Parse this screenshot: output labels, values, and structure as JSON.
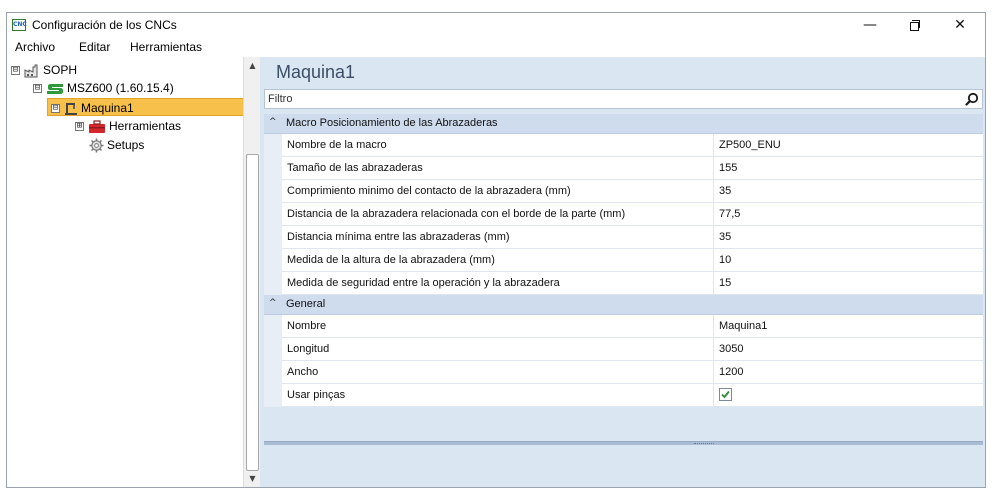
{
  "window": {
    "title": "Configuración de los CNCs",
    "app_icon": "cnc-app-icon",
    "app_icon_text": "CNC",
    "controls": {
      "minimize": "—",
      "close": "✕"
    }
  },
  "menu": {
    "items": [
      "Archivo",
      "Editar",
      "Herramientas"
    ]
  },
  "tree": {
    "nodes": [
      {
        "label": "SOPH",
        "icon": "factory-icon",
        "expander": "⊟"
      },
      {
        "label": "MSZ600 (1.60.15.4)",
        "icon": "s-logo-icon",
        "expander": "⊟"
      },
      {
        "label": "Maquina1",
        "icon": "machine-icon",
        "expander": "⊟",
        "selected": true
      },
      {
        "label": "Herramientas",
        "icon": "toolbox-icon",
        "expander": "⊞"
      },
      {
        "label": "Setups",
        "icon": "gear-icon"
      }
    ]
  },
  "scrollbar": {
    "up": "▲",
    "down": "▼"
  },
  "properties": {
    "title": "Maquina1",
    "filter_label": "Filtro",
    "toggle_symbol": "^",
    "categories": [
      {
        "label": "Macro Posicionamiento de las Abrazaderas",
        "rows": [
          {
            "name": "Nombre de la macro",
            "value": "ZP500_ENU"
          },
          {
            "name": "Tamaño de las abrazaderas",
            "value": "155"
          },
          {
            "name": "Comprimiento minimo del contacto de la abrazadera (mm)",
            "value": "35"
          },
          {
            "name": "Distancia de la abrazadera relacionada con el borde de la parte (mm)",
            "value": "77,5"
          },
          {
            "name": "Distancia mínima entre las abrazaderas (mm)",
            "value": "35"
          },
          {
            "name": "Medida de la altura de la abrazadera (mm)",
            "value": "10"
          },
          {
            "name": "Medida de seguridad entre la operación y la abrazadera",
            "value": "15"
          }
        ]
      },
      {
        "label": "General",
        "rows": [
          {
            "name": "Nombre",
            "value": "Maquina1"
          },
          {
            "name": "Longitud",
            "value": "3050"
          },
          {
            "name": "Ancho",
            "value": "1200"
          },
          {
            "name": "Usar pinças",
            "checked": true
          }
        ]
      }
    ]
  },
  "colors": {
    "selection": "#f7c04b",
    "panel_bg": "#dbe6f3",
    "category_bg": "#cfdcee",
    "title_text": "#3c4e66",
    "check_green": "#2e8b3a"
  }
}
